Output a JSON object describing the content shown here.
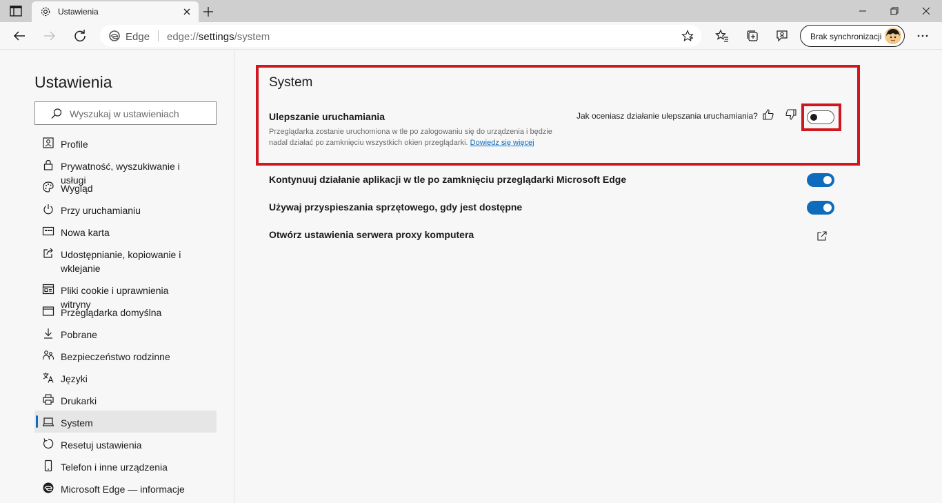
{
  "browser": {
    "tab_title": "Ustawienia",
    "address": {
      "brand": "Edge",
      "url_scheme": "edge://",
      "url_host": "settings",
      "url_path": "/system"
    },
    "profile_label": "Brak synchronizacji"
  },
  "sidebar": {
    "title": "Ustawienia",
    "search_placeholder": "Wyszukaj w ustawieniach",
    "items": [
      {
        "label": "Profile",
        "icon": "profile-icon"
      },
      {
        "label": "Prywatność, wyszukiwanie i usługi",
        "icon": "lock-icon"
      },
      {
        "label": "Wygląd",
        "icon": "palette-icon"
      },
      {
        "label": "Przy uruchamianiu",
        "icon": "power-icon"
      },
      {
        "label": "Nowa karta",
        "icon": "new-tab-page-icon"
      },
      {
        "label": "Udostępnianie, kopiowanie i wklejanie",
        "icon": "share-icon"
      },
      {
        "label": "Pliki cookie i uprawnienia witryny",
        "icon": "site-permissions-icon"
      },
      {
        "label": "Przeglądarka domyślna",
        "icon": "default-browser-icon"
      },
      {
        "label": "Pobrane",
        "icon": "download-icon"
      },
      {
        "label": "Bezpieczeństwo rodzinne",
        "icon": "family-icon"
      },
      {
        "label": "Języki",
        "icon": "languages-icon"
      },
      {
        "label": "Drukarki",
        "icon": "printer-icon"
      },
      {
        "label": "System",
        "icon": "system-icon",
        "active": true
      },
      {
        "label": "Resetuj ustawienia",
        "icon": "reset-icon"
      },
      {
        "label": "Telefon i inne urządzenia",
        "icon": "phone-icon"
      },
      {
        "label": "Microsoft Edge — informacje",
        "icon": "edge-logo-icon"
      }
    ]
  },
  "main": {
    "section_title": "System",
    "startup_boost": {
      "title": "Ulepszanie uruchamiania",
      "description": "Przeglądarka zostanie uruchomiona w tle po zalogowaniu się do urządzenia i będzie nadal działać po zamknięciu wszystkich okien przeglądarki.",
      "learn_more": "Dowiedz się więcej",
      "rating_question": "Jak oceniasz działanie ulepszania uruchamiania?",
      "enabled": false
    },
    "settings": [
      {
        "label": "Kontynuuj działanie aplikacji w tle po zamknięciu przeglądarki Microsoft Edge",
        "control": "toggle",
        "enabled": true
      },
      {
        "label": "Używaj przyspieszania sprzętowego, gdy jest dostępne",
        "control": "toggle",
        "enabled": true
      },
      {
        "label": "Otwórz ustawienia serwera proxy komputera",
        "control": "external-link"
      }
    ]
  },
  "colors": {
    "accent": "#0f6cbd",
    "highlight": "#d0161e"
  }
}
